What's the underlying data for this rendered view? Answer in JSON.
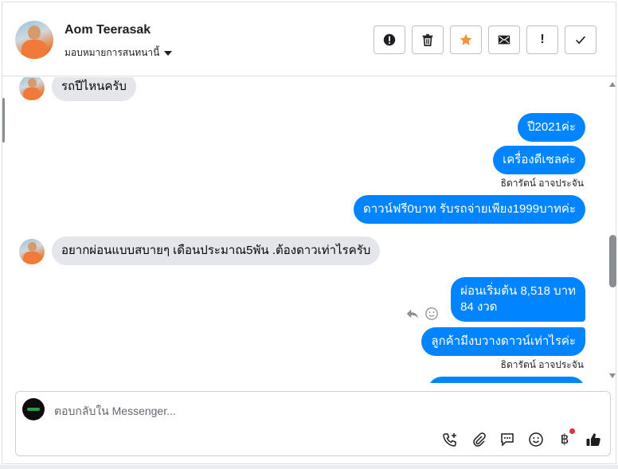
{
  "header": {
    "contact_name": "Aom Teerasak",
    "assign_label": "มอบหมายการสนทนานี้",
    "actions": [
      {
        "name": "spam-button",
        "icon": "alert-circle-icon"
      },
      {
        "name": "delete-button",
        "icon": "trash-icon"
      },
      {
        "name": "star-button",
        "icon": "star-icon",
        "color": "#f7923b"
      },
      {
        "name": "mark-unread-button",
        "icon": "envelope-icon"
      },
      {
        "name": "follow-up-button",
        "icon": "exclamation-icon",
        "label": "!"
      },
      {
        "name": "done-button",
        "icon": "check-icon"
      }
    ]
  },
  "messages": [
    {
      "direction": "in",
      "text": "รถปีไหนครับ"
    },
    {
      "direction": "out",
      "text": "ปี2021ค่ะ"
    },
    {
      "direction": "out",
      "text": "เครื่องดีเซลค่ะ",
      "sender": "ธิดารัตน์ อาจประจัน"
    },
    {
      "direction": "out",
      "text": "ดาวน์ฟรี0บาท รับรถจ่ายเพียง1999บาทค่ะ"
    },
    {
      "direction": "in",
      "text": "อยากผ่อนแบบสบายๆ เดือนประมาณ5พัน .ต้องดาวเท่าไรครับ"
    },
    {
      "direction": "out",
      "text_line1": "ผ่อนเริ่มต้น 8,518 บาท",
      "text_line2": "84 งวด"
    },
    {
      "direction": "out",
      "text": "ลูกค้ามีงบวางดาวน์เท่าไรค่ะ",
      "sender": "ธิดารัตน์ อาจประจัน"
    }
  ],
  "composer": {
    "placeholder": "ตอบกลับใน Messenger...",
    "tools": [
      "add-call-icon",
      "paperclip-icon",
      "saved-reply-icon",
      "emoji-icon",
      "baht-payment-icon",
      "thumbs-up-icon"
    ],
    "baht_symbol": "฿",
    "notification_color": "#f02849"
  },
  "colors": {
    "outgoing_bubble": "#0084ff",
    "incoming_bubble": "#e4e6eb"
  }
}
